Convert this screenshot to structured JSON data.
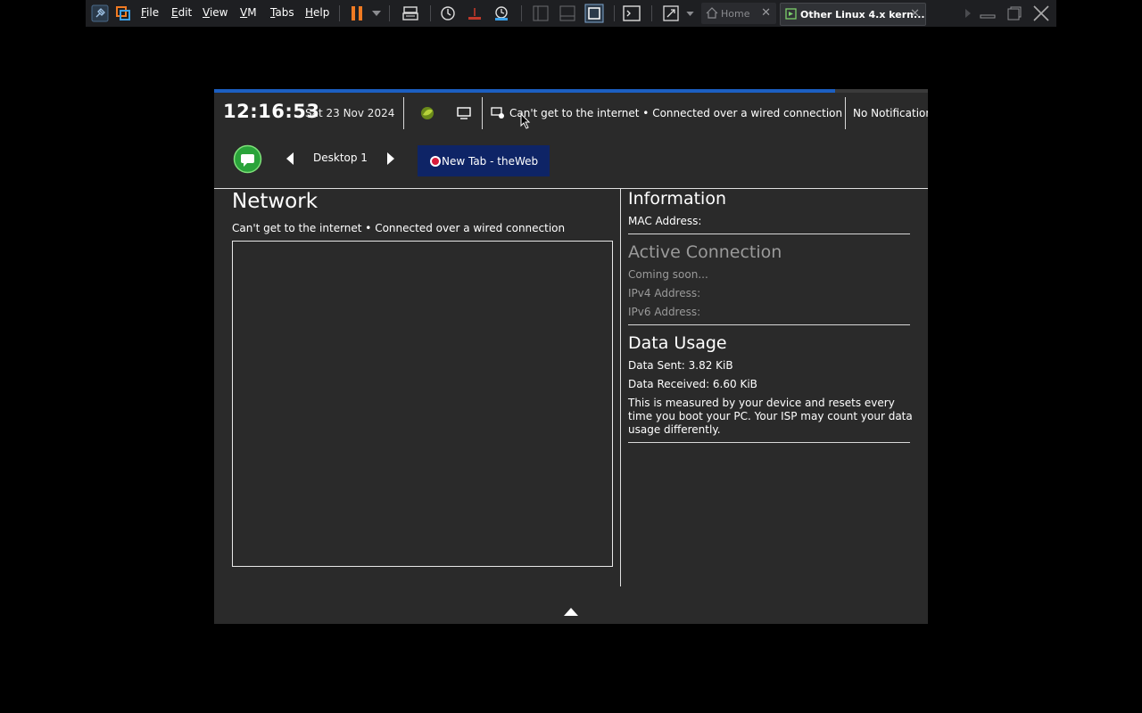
{
  "vm_toolbar": {
    "menus": [
      {
        "label": "File"
      },
      {
        "label": "Edit"
      },
      {
        "label": "View"
      },
      {
        "label": "VM"
      },
      {
        "label": "Tabs"
      },
      {
        "label": "Help"
      }
    ],
    "tabs": [
      {
        "label": "Home",
        "active": false
      },
      {
        "label": "Other Linux 4.x kern...",
        "active": true
      }
    ],
    "accent_color": "#f07a22"
  },
  "guest": {
    "progress_fraction": 0.87,
    "top_bar": {
      "clock": "12:16:53",
      "date": "Sat 23 Nov 2024",
      "network_status": "Can't get to the internet • Connected over a wired connection",
      "notifications": "No Notifications"
    },
    "desktop": {
      "label": "Desktop 1",
      "open_window": "New Tab - theWeb"
    },
    "network_panel": {
      "title": "Network",
      "subtitle": "Can't get to the internet • Connected over a wired connection"
    },
    "information": {
      "title": "Information",
      "mac_label": "MAC Address:"
    },
    "active_connection": {
      "title": "Active Connection",
      "coming_soon": "Coming soon...",
      "ipv4_label": "IPv4 Address:",
      "ipv6_label": "IPv6 Address:"
    },
    "data_usage": {
      "title": "Data Usage",
      "sent": "Data Sent: 3.82 KiB",
      "received": "Data Received: 6.60 KiB",
      "note": "This is measured by your device and resets every time you boot your PC. Your ISP may count your data usage differently."
    }
  }
}
